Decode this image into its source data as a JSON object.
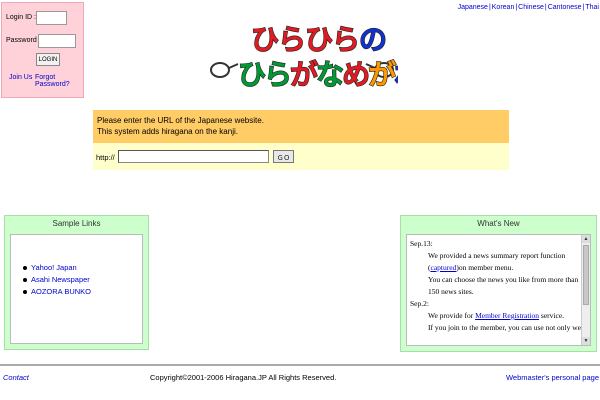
{
  "login": {
    "id_label": "Login ID :",
    "password_label": "Password :",
    "login_button": "LOGIN",
    "join_link": "Join Us",
    "forgot_link": "Forgot Password?"
  },
  "languages": [
    "Japanese",
    "Korean",
    "Chinese",
    "Cantonese",
    "Thai"
  ],
  "logo": {
    "line1": "ひらひらの",
    "line2": "ひらがなめがね",
    "colors": [
      "#e11b22",
      "#009933",
      "#1133cc",
      "#ff9900"
    ]
  },
  "url_panel": {
    "line1": "Please enter the URL of the Japanese website.",
    "line2": "This system adds hiragana on the kanji.",
    "http_label": "http://",
    "url_value": "",
    "go_button": "ＧＯ"
  },
  "sample_links": {
    "title": "Sample Links",
    "items": [
      "Yahoo! Japan",
      "Asahi Newspaper",
      "AOZORA BUNKO"
    ]
  },
  "whats_new": {
    "title": "What's New",
    "items": [
      {
        "date": "Sep.13:",
        "p1_a": "We provided a news summary report function",
        "p1_link": "captured",
        "p1_b": "on member menu.",
        "p2": "You can choose the news you like from more than 150 news sites."
      },
      {
        "date": "Sep.2:",
        "p1_a": "We provide for ",
        "p1_link": "Member Registration",
        "p1_b": " service.",
        "p2": "If you join to the member, you can use not only web"
      }
    ]
  },
  "footer": {
    "contact": "Contact",
    "copyright": "Copyright©2001-2006 Hiragana.JP All Rights Reserved.",
    "webmaster": "Webmaster's personal page"
  },
  "colors": {
    "login_bg": "#ffd2da",
    "panel_orange": "#ffcc66",
    "panel_yellow": "#ffffcc",
    "box_green": "#ccffcc",
    "link_blue": "#0000cc"
  }
}
